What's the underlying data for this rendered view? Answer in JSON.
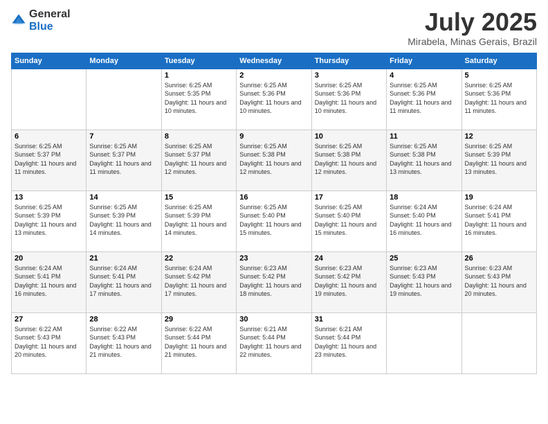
{
  "header": {
    "logo_general": "General",
    "logo_blue": "Blue",
    "month": "July 2025",
    "location": "Mirabela, Minas Gerais, Brazil"
  },
  "weekdays": [
    "Sunday",
    "Monday",
    "Tuesday",
    "Wednesday",
    "Thursday",
    "Friday",
    "Saturday"
  ],
  "weeks": [
    [
      {
        "day": "",
        "info": ""
      },
      {
        "day": "",
        "info": ""
      },
      {
        "day": "1",
        "info": "Sunrise: 6:25 AM\nSunset: 5:35 PM\nDaylight: 11 hours and 10 minutes."
      },
      {
        "day": "2",
        "info": "Sunrise: 6:25 AM\nSunset: 5:36 PM\nDaylight: 11 hours and 10 minutes."
      },
      {
        "day": "3",
        "info": "Sunrise: 6:25 AM\nSunset: 5:36 PM\nDaylight: 11 hours and 10 minutes."
      },
      {
        "day": "4",
        "info": "Sunrise: 6:25 AM\nSunset: 5:36 PM\nDaylight: 11 hours and 11 minutes."
      },
      {
        "day": "5",
        "info": "Sunrise: 6:25 AM\nSunset: 5:36 PM\nDaylight: 11 hours and 11 minutes."
      }
    ],
    [
      {
        "day": "6",
        "info": "Sunrise: 6:25 AM\nSunset: 5:37 PM\nDaylight: 11 hours and 11 minutes."
      },
      {
        "day": "7",
        "info": "Sunrise: 6:25 AM\nSunset: 5:37 PM\nDaylight: 11 hours and 11 minutes."
      },
      {
        "day": "8",
        "info": "Sunrise: 6:25 AM\nSunset: 5:37 PM\nDaylight: 11 hours and 12 minutes."
      },
      {
        "day": "9",
        "info": "Sunrise: 6:25 AM\nSunset: 5:38 PM\nDaylight: 11 hours and 12 minutes."
      },
      {
        "day": "10",
        "info": "Sunrise: 6:25 AM\nSunset: 5:38 PM\nDaylight: 11 hours and 12 minutes."
      },
      {
        "day": "11",
        "info": "Sunrise: 6:25 AM\nSunset: 5:38 PM\nDaylight: 11 hours and 13 minutes."
      },
      {
        "day": "12",
        "info": "Sunrise: 6:25 AM\nSunset: 5:39 PM\nDaylight: 11 hours and 13 minutes."
      }
    ],
    [
      {
        "day": "13",
        "info": "Sunrise: 6:25 AM\nSunset: 5:39 PM\nDaylight: 11 hours and 13 minutes."
      },
      {
        "day": "14",
        "info": "Sunrise: 6:25 AM\nSunset: 5:39 PM\nDaylight: 11 hours and 14 minutes."
      },
      {
        "day": "15",
        "info": "Sunrise: 6:25 AM\nSunset: 5:39 PM\nDaylight: 11 hours and 14 minutes."
      },
      {
        "day": "16",
        "info": "Sunrise: 6:25 AM\nSunset: 5:40 PM\nDaylight: 11 hours and 15 minutes."
      },
      {
        "day": "17",
        "info": "Sunrise: 6:25 AM\nSunset: 5:40 PM\nDaylight: 11 hours and 15 minutes."
      },
      {
        "day": "18",
        "info": "Sunrise: 6:24 AM\nSunset: 5:40 PM\nDaylight: 11 hours and 16 minutes."
      },
      {
        "day": "19",
        "info": "Sunrise: 6:24 AM\nSunset: 5:41 PM\nDaylight: 11 hours and 16 minutes."
      }
    ],
    [
      {
        "day": "20",
        "info": "Sunrise: 6:24 AM\nSunset: 5:41 PM\nDaylight: 11 hours and 16 minutes."
      },
      {
        "day": "21",
        "info": "Sunrise: 6:24 AM\nSunset: 5:41 PM\nDaylight: 11 hours and 17 minutes."
      },
      {
        "day": "22",
        "info": "Sunrise: 6:24 AM\nSunset: 5:42 PM\nDaylight: 11 hours and 17 minutes."
      },
      {
        "day": "23",
        "info": "Sunrise: 6:23 AM\nSunset: 5:42 PM\nDaylight: 11 hours and 18 minutes."
      },
      {
        "day": "24",
        "info": "Sunrise: 6:23 AM\nSunset: 5:42 PM\nDaylight: 11 hours and 19 minutes."
      },
      {
        "day": "25",
        "info": "Sunrise: 6:23 AM\nSunset: 5:43 PM\nDaylight: 11 hours and 19 minutes."
      },
      {
        "day": "26",
        "info": "Sunrise: 6:23 AM\nSunset: 5:43 PM\nDaylight: 11 hours and 20 minutes."
      }
    ],
    [
      {
        "day": "27",
        "info": "Sunrise: 6:22 AM\nSunset: 5:43 PM\nDaylight: 11 hours and 20 minutes."
      },
      {
        "day": "28",
        "info": "Sunrise: 6:22 AM\nSunset: 5:43 PM\nDaylight: 11 hours and 21 minutes."
      },
      {
        "day": "29",
        "info": "Sunrise: 6:22 AM\nSunset: 5:44 PM\nDaylight: 11 hours and 21 minutes."
      },
      {
        "day": "30",
        "info": "Sunrise: 6:21 AM\nSunset: 5:44 PM\nDaylight: 11 hours and 22 minutes."
      },
      {
        "day": "31",
        "info": "Sunrise: 6:21 AM\nSunset: 5:44 PM\nDaylight: 11 hours and 23 minutes."
      },
      {
        "day": "",
        "info": ""
      },
      {
        "day": "",
        "info": ""
      }
    ]
  ]
}
